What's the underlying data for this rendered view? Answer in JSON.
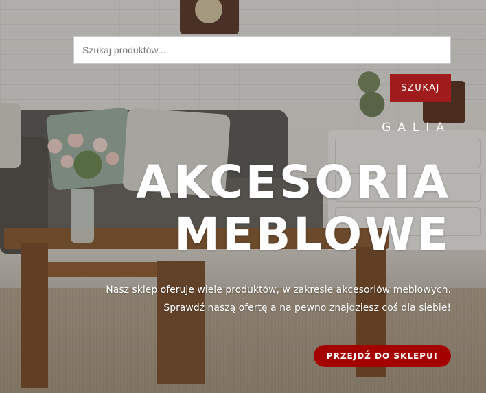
{
  "search": {
    "placeholder": "Szukaj produktów...",
    "button_label": "SZUKAJ"
  },
  "hero": {
    "brand": "GALIA",
    "headline_line1": "AKCESORIA",
    "headline_line2": "MEBLOWE",
    "description_line1": "Nasz sklep oferuje wiele produktów, w zakresie akcesoriów meblowych.",
    "description_line2": "Sprawdź naszą ofertę a na pewno znajdziesz coś  dla siebie!",
    "cta_label": "PRZEJDŹ DO SKLEPU!"
  },
  "colors": {
    "accent": "#a01c1c",
    "cta": "#a50000",
    "text": "#ffffff"
  }
}
